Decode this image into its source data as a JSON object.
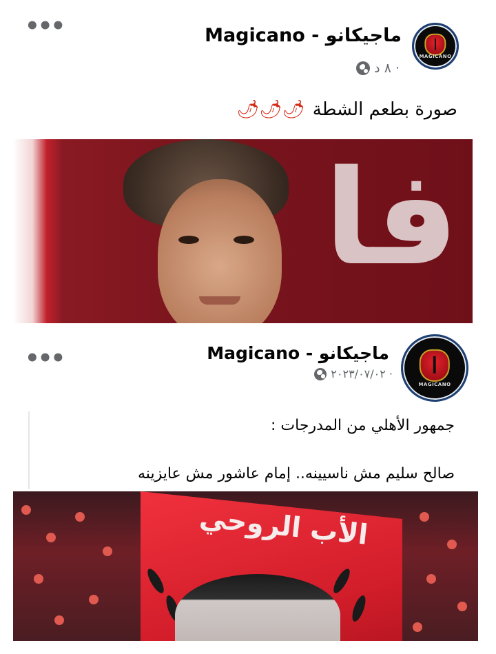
{
  "post1": {
    "page_name": "Magicano - ماجيكانو",
    "time": "٨ د ·",
    "caption": "صورة بطعم الشطة",
    "caption_emoji": "🌶🌶🌶",
    "avatar_text": "MAGICANO"
  },
  "post2": {
    "page_name": "Magicano - ماجيكانو",
    "date": "٢٠٢٣/٠٧/٠٢ ·",
    "line1": "جمهور الأهلي من المدرجات :",
    "line2": "صالح سليم مش ناسيينه.. إمام عاشور مش عايزينه",
    "flag_text": "الأب الروحي",
    "avatar_text": "MAGICANO"
  },
  "icons": {
    "menu": "more-horizontal-icon",
    "privacy": "globe-icon"
  },
  "colors": {
    "avatar_ring": "#1d3f73",
    "meta_gray": "#65676b",
    "photo1_bg": "#7a141d",
    "flag_red": "#d21d2a"
  }
}
